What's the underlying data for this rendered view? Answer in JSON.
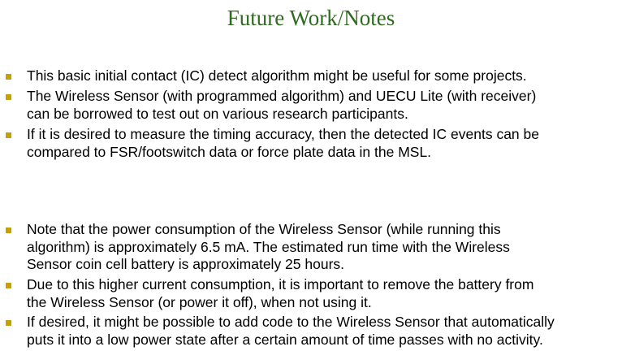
{
  "slide": {
    "title": "Future Work/Notes",
    "bullets": [
      {
        "lines": [
          "This basic initial contact (IC) detect algorithm might be useful for some projects."
        ]
      },
      {
        "lines": [
          "The Wireless Sensor (with programmed algorithm) and UECU Lite (with receiver)",
          "can be borrowed to test out on various research participants."
        ]
      },
      {
        "lines": [
          "If it is desired to measure the timing accuracy, then the detected IC events can be",
          "compared to FSR/footswitch data or force plate data in the MSL."
        ]
      },
      {
        "lines": [
          "Note that the power consumption of the Wireless Sensor (while running this",
          "algorithm) is approximately 6.5 mA.  The estimated run time with the Wireless",
          "Sensor coin cell battery is approximately 25 hours."
        ]
      },
      {
        "lines": [
          "Due to this higher current consumption, it is important to remove the battery from",
          "the Wireless Sensor (or power it off), when not using it."
        ]
      },
      {
        "lines": [
          "If desired, it might be possible to add code to the Wireless Sensor that automatically",
          "puts it into a low power state after a certain amount of time passes with no activity."
        ]
      }
    ],
    "colors": {
      "title": "#2f6b1f",
      "bullet_marker": "#c8a000",
      "text": "#000000",
      "background": "#ffffff"
    },
    "icons": {
      "bullet_marker": "square-bullet-icon"
    }
  }
}
